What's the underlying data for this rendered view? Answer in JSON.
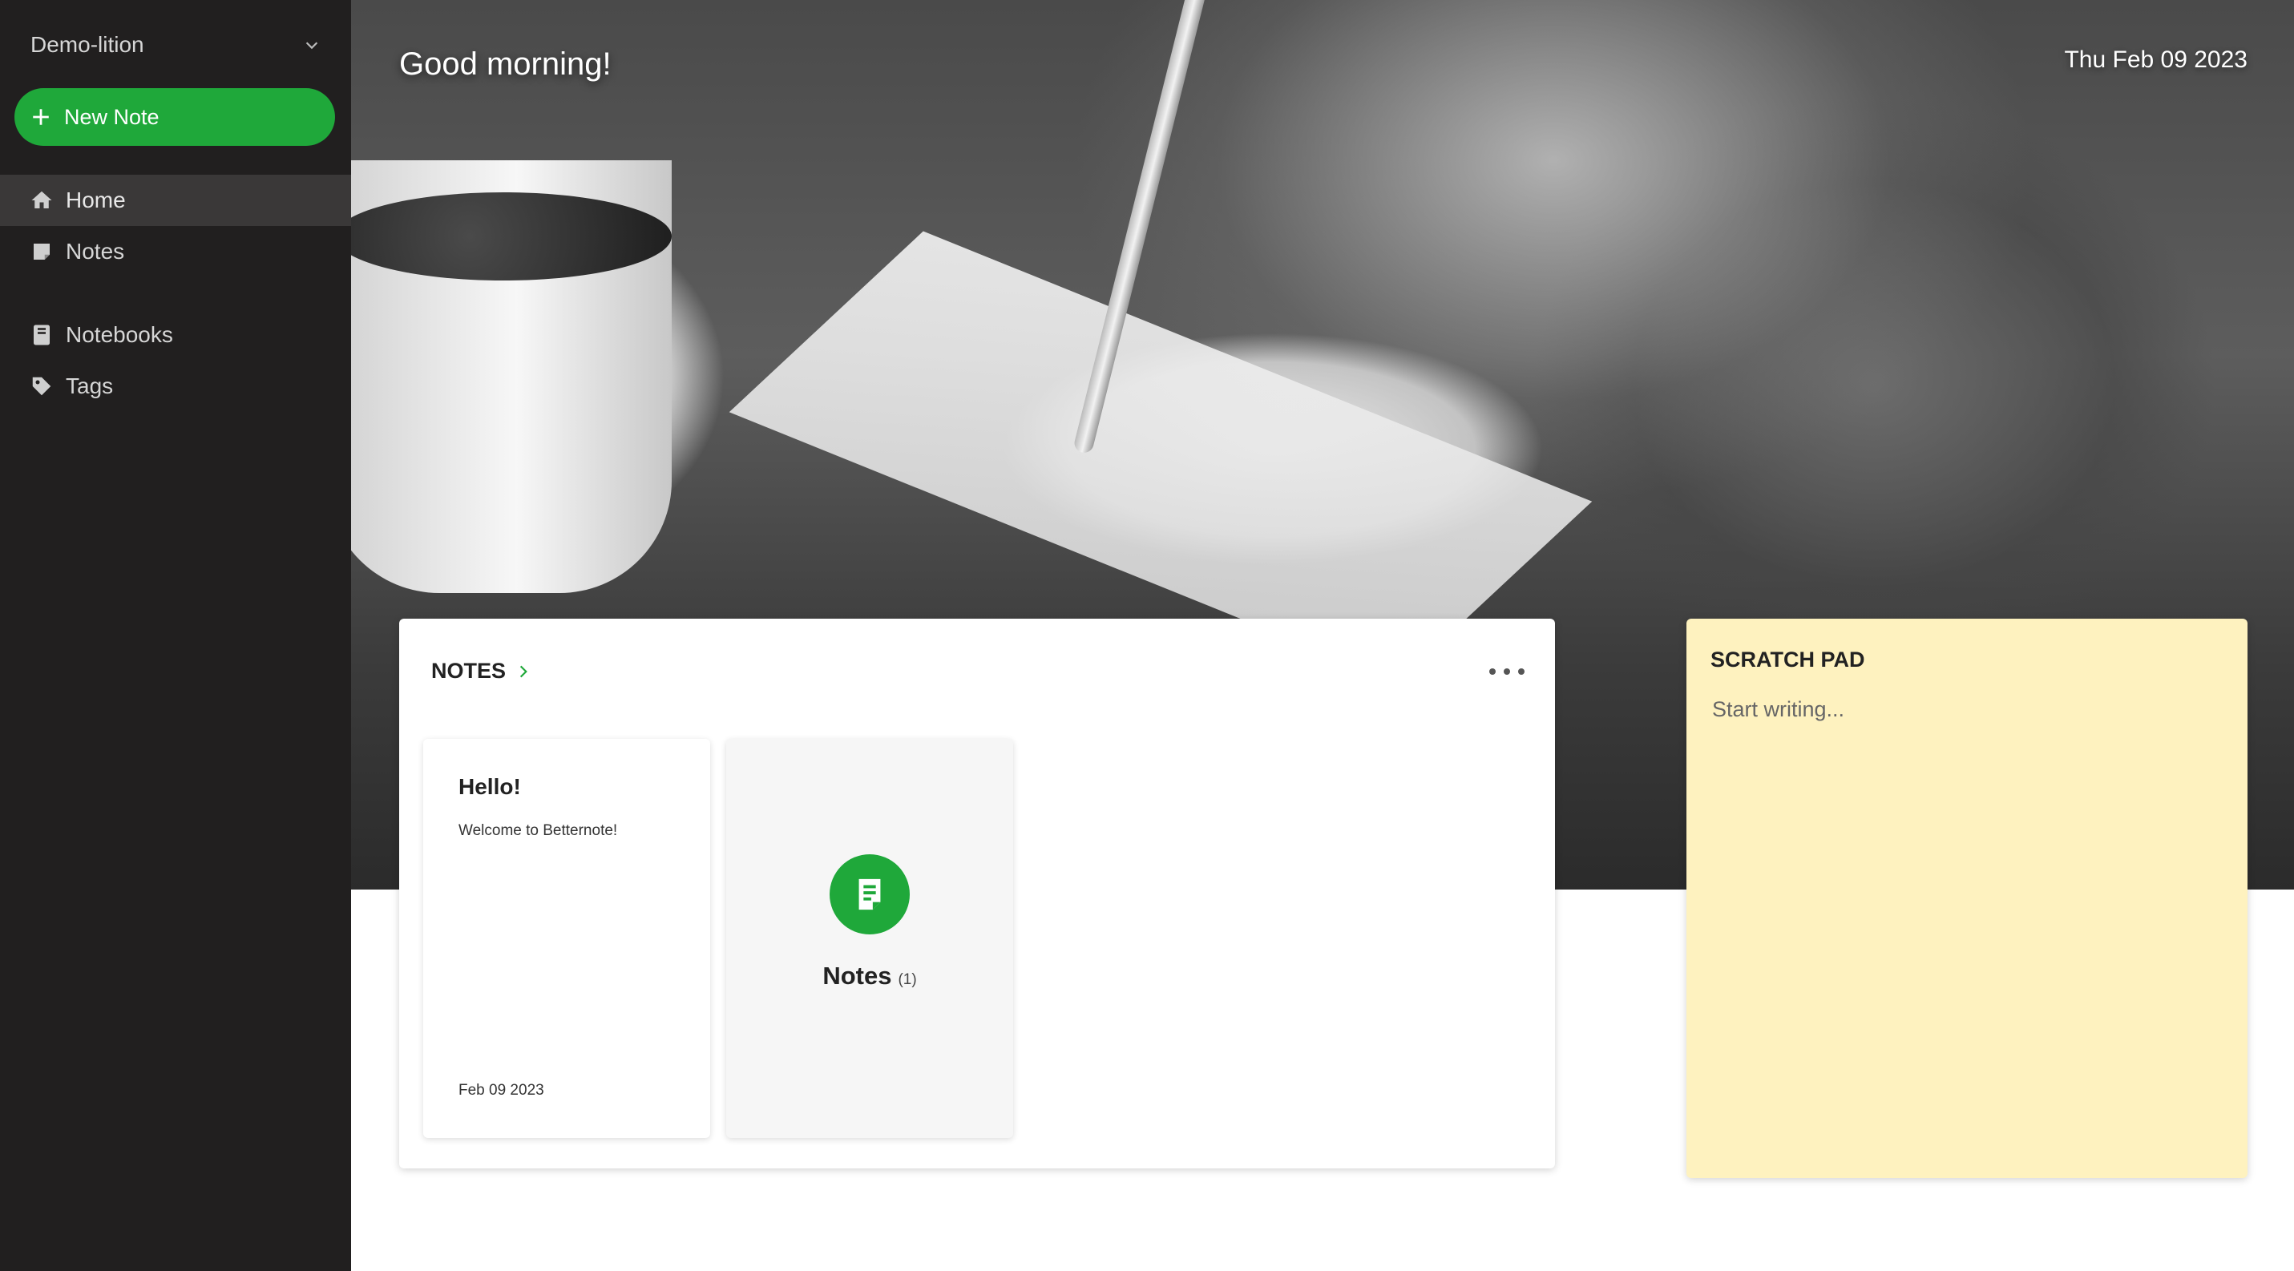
{
  "sidebar": {
    "account_name": "Demo-lition",
    "new_note_label": "New Note",
    "nav": [
      {
        "label": "Home",
        "icon": "home-icon",
        "active": true
      },
      {
        "label": "Notes",
        "icon": "note-icon"
      },
      {
        "label": "Notebooks",
        "icon": "notebook-icon"
      },
      {
        "label": "Tags",
        "icon": "tag-icon"
      }
    ]
  },
  "hero": {
    "greeting": "Good morning!",
    "date": "Thu Feb 09 2023"
  },
  "notes_widget": {
    "title": "NOTES",
    "note_card": {
      "title": "Hello!",
      "body": "Welcome to Betternote!",
      "date": "Feb 09 2023"
    },
    "notes_shortcut": {
      "label": "Notes",
      "count": "(1)"
    }
  },
  "scratch_pad": {
    "title": "SCRATCH PAD",
    "placeholder": "Start writing..."
  },
  "colors": {
    "sidebar_bg": "#211f1f",
    "accent_green": "#1fa83a",
    "scratch_bg": "#fef2bf"
  }
}
